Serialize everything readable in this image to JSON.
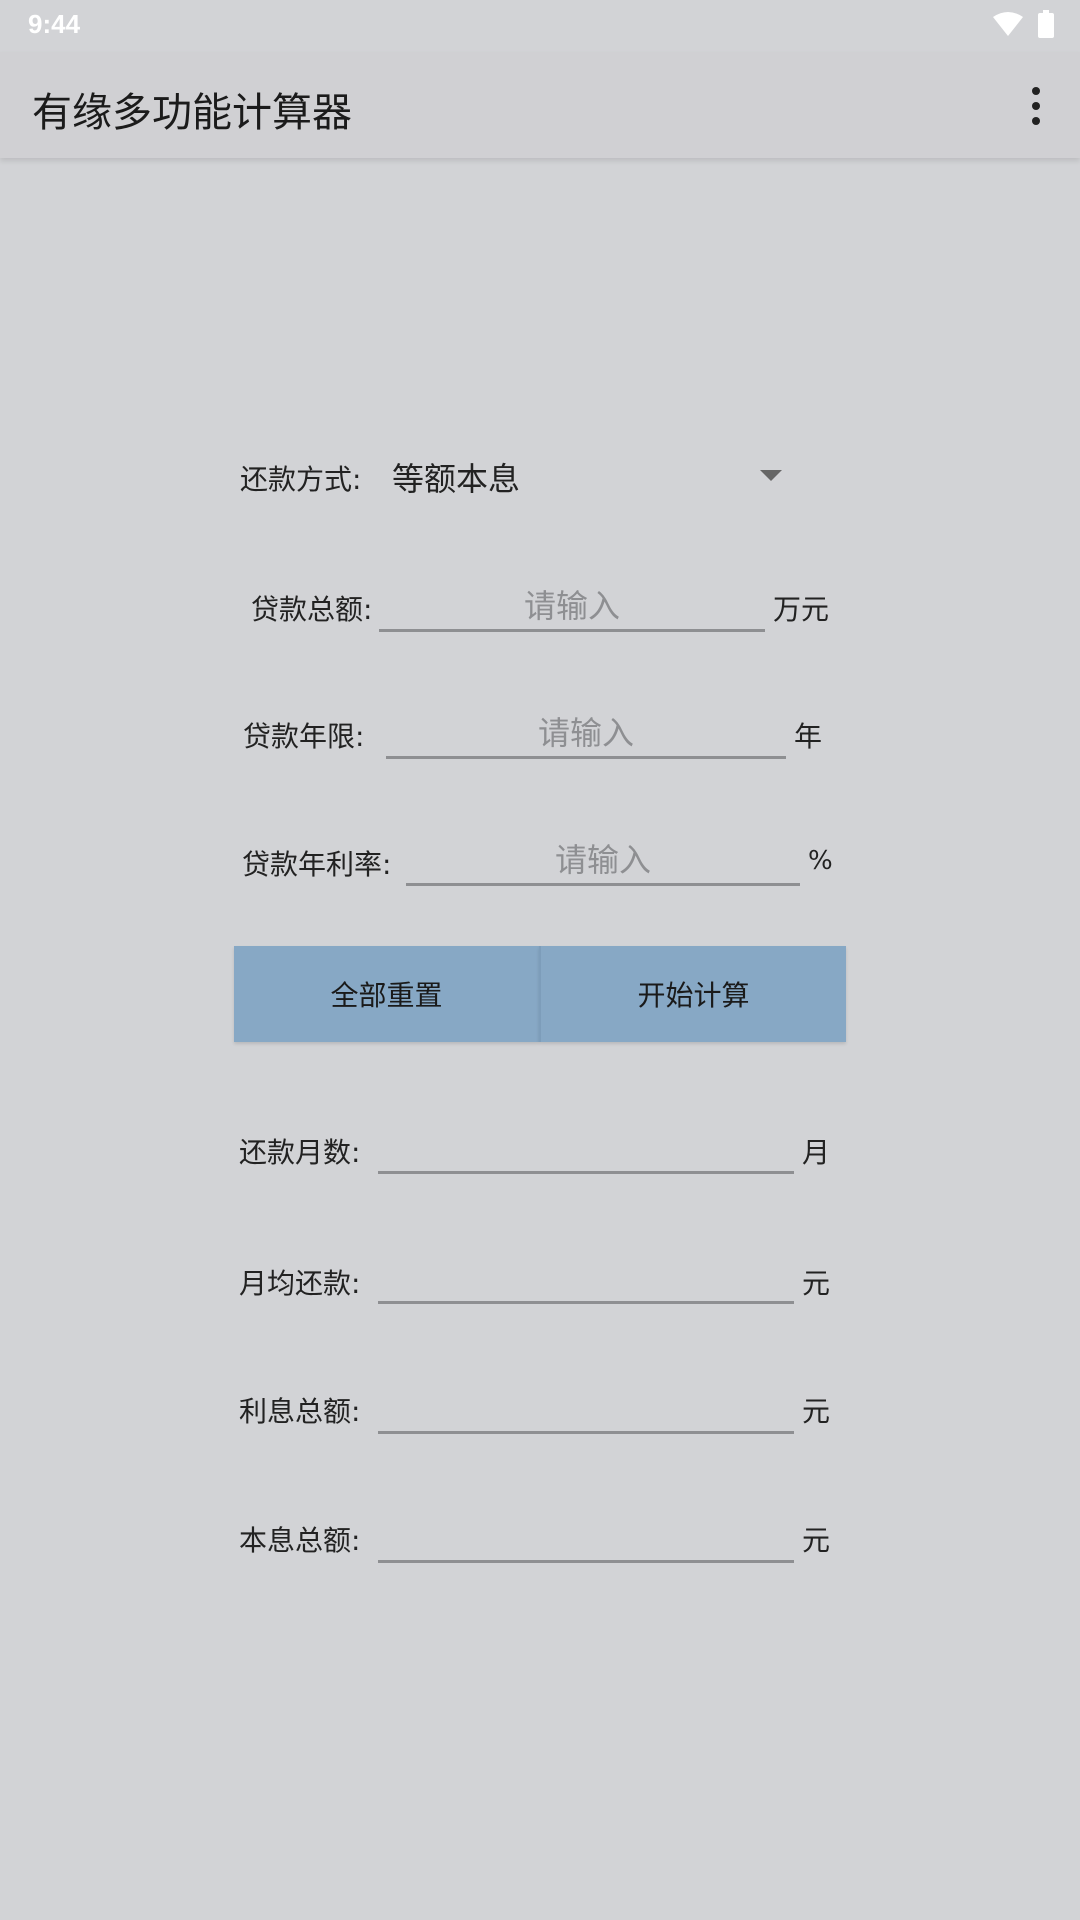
{
  "status": {
    "time": "9:44"
  },
  "app": {
    "title": "有缘多功能计算器"
  },
  "repayment_method": {
    "label": "还款方式:",
    "value": "等额本息"
  },
  "loan_amount": {
    "label": "贷款总额:",
    "placeholder": "请输入",
    "unit": "万元"
  },
  "loan_years": {
    "label": "贷款年限:",
    "placeholder": "请输入",
    "unit": "年"
  },
  "annual_rate": {
    "label": "贷款年利率:",
    "placeholder": "请输入",
    "unit": "%"
  },
  "buttons": {
    "reset": "全部重置",
    "calculate": "开始计算"
  },
  "results": {
    "months": {
      "label": "还款月数:",
      "unit": "月"
    },
    "monthly_payment": {
      "label": "月均还款:",
      "unit": "元"
    },
    "total_interest": {
      "label": "利息总额:",
      "unit": "元"
    },
    "total_amount": {
      "label": "本息总额:",
      "unit": "元"
    }
  }
}
